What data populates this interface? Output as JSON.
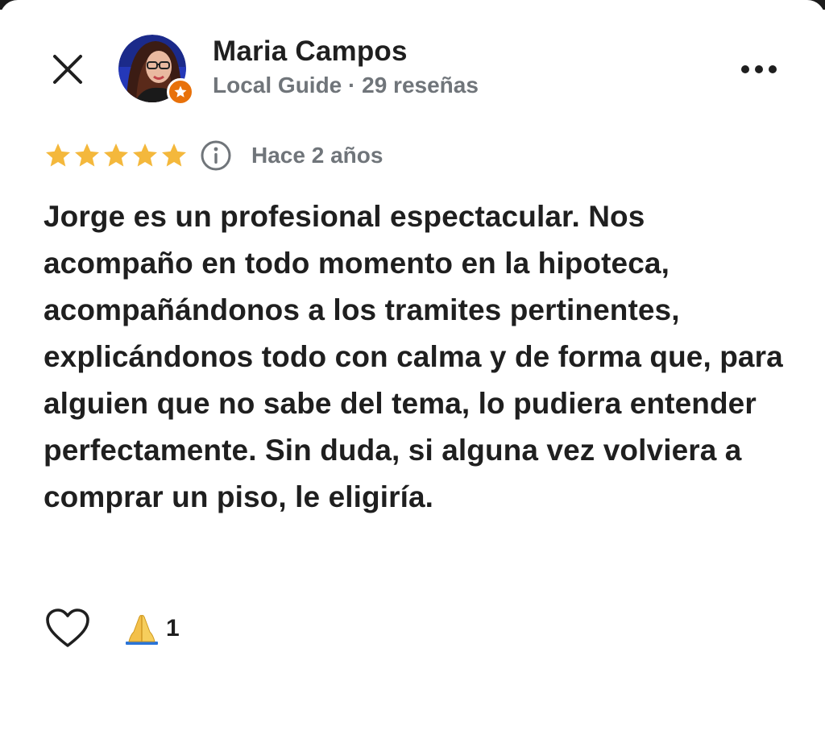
{
  "author": {
    "name": "Maria Campos",
    "meta": "Local Guide · 29 reseñas",
    "badge_icon": "local-guide-star-icon",
    "badge_color": "#e8710a"
  },
  "header": {
    "close_icon": "close-icon",
    "more_icon": "more-options-icon"
  },
  "review": {
    "rating": 5,
    "max_rating": 5,
    "star_color": "#f4b83c",
    "info_icon": "info-icon",
    "time_ago": "Hace 2 años",
    "text": "Jorge es un profesional espectacular. Nos acompaño en todo momento en la hipoteca, acompañándonos a los tramites pertinentes, explicándonos todo con calma y de forma que, para alguien que no sabe del tema, lo pudiera entender perfectamente. Sin duda, si alguna vez volviera a comprar un piso, le eligiría."
  },
  "actions": {
    "like_icon": "heart-outline-icon",
    "reaction_icon": "folded-hands-emoji-icon",
    "reaction_count": "1"
  }
}
